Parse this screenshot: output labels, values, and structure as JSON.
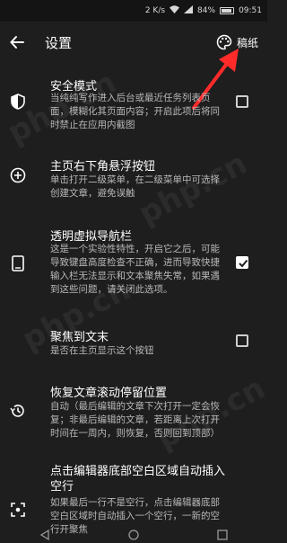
{
  "status_bar": {
    "speed": "2 K/s",
    "battery": "84%",
    "time": "09:51"
  },
  "app_bar": {
    "title": "设置",
    "draft_label": "稿纸"
  },
  "settings": [
    {
      "title": "安全模式",
      "desc": "当纯纯写作进入后台或最近任务列表页面，模糊化其页面内容；开启此项后将同时禁止在应用内截图",
      "checked": false,
      "icon": "shield-icon"
    },
    {
      "title": "主页右下角悬浮按钮",
      "desc": "单击打开二级菜单，在二级菜单中可选择创建文章，避免误触",
      "icon": "add-circle-icon"
    },
    {
      "title": "透明虚拟导航栏",
      "desc": "这是一个实验性特性，开启它之后，可能导致键盘高度检查不正确，进而导致快捷输入栏无法显示和文本聚焦失常，如果遇到这些问题，请关闭此选项。",
      "checked": true,
      "icon": "phone-icon"
    },
    {
      "title": "聚焦到文末",
      "desc": "是否在主页显示这个按钮",
      "checked": false,
      "icon": ""
    },
    {
      "title": "恢复文章滚动停留位置",
      "desc": "自动（最后编辑的文章下次打开一定会恢复；非最后编辑的文章，若距离上次打开时间在一周内，则恢复，否则回到顶部）",
      "icon": "history-icon"
    },
    {
      "title": "点击编辑器底部空白区域自动插入空行",
      "desc": "如果最后一行不是空行，点击编辑器底部空白区域时自动插入一个空行，一新的空行开聚焦",
      "icon": "focus-icon"
    }
  ],
  "watermark": "php.cn",
  "colors": {
    "background": "#1e1e1e",
    "accent": "#ff2b2b"
  }
}
